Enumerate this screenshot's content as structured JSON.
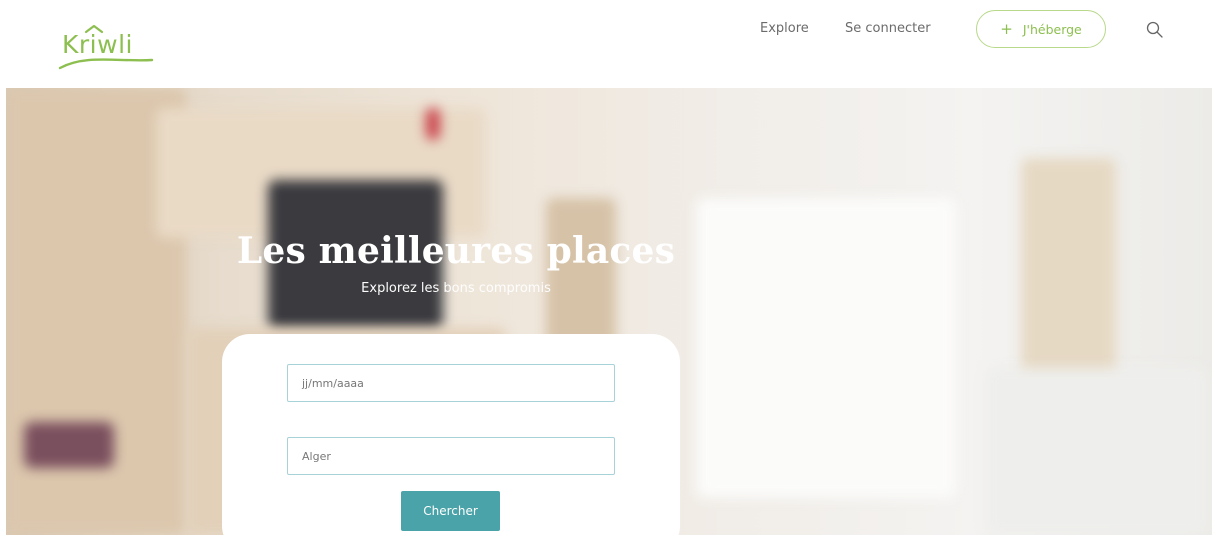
{
  "brand": {
    "logo_text": "Krīwli",
    "colors": {
      "accent": "#8cbf4f",
      "button": "#4aa3a8",
      "field_border": "#a7d2d8"
    }
  },
  "nav": {
    "explore_label": "Explore",
    "login_label": "Se connecter",
    "host_button": {
      "icon": "plus-icon",
      "label": "J'héberge"
    },
    "search_icon": "search-icon"
  },
  "hero": {
    "title": "Les meilleures places",
    "subtitle": "Explorez les bons compromis"
  },
  "search_form": {
    "date_placeholder": "jj/mm/aaaa",
    "city_value": "Alger",
    "submit_label": "Chercher"
  }
}
